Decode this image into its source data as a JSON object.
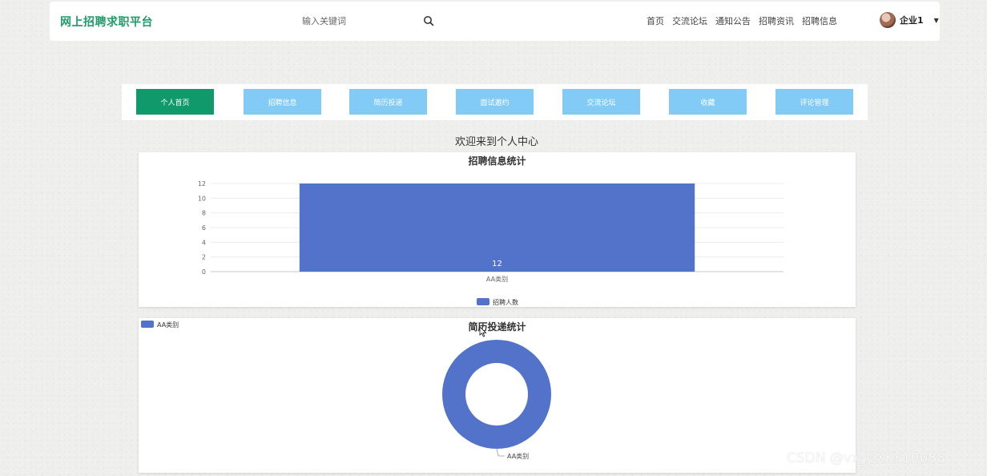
{
  "header": {
    "logo": "网上招聘求职平台",
    "search_placeholder": "输入关键词",
    "nav": [
      "首页",
      "交流论坛",
      "通知公告",
      "招聘资讯",
      "招聘信息"
    ],
    "user_name": "企业1"
  },
  "tabs": [
    "个人首页",
    "招聘信息",
    "简历投递",
    "面试邀约",
    "交流论坛",
    "收藏",
    "评论管理"
  ],
  "active_tab": 0,
  "welcome": "欢迎来到个人中心",
  "colors": {
    "brand": "#1f9a6b",
    "tab": "#83cbf7",
    "tab_active": "#10996b",
    "series": "#5273c9"
  },
  "chart_data": [
    {
      "type": "bar",
      "title": "招聘信息统计",
      "categories": [
        "AA类别"
      ],
      "series": [
        {
          "name": "招聘人数",
          "values": [
            12
          ]
        }
      ],
      "ylim": [
        0,
        12
      ],
      "yticks": [
        0,
        2,
        4,
        6,
        8,
        10,
        12
      ],
      "grid": true,
      "legend": "bottom-center",
      "data_labels": true
    },
    {
      "type": "pie",
      "title": "简历投递统计",
      "labels": [
        "AA类别"
      ],
      "values": [
        1
      ],
      "donut": true,
      "legend": "top-left"
    }
  ],
  "watermark": "CSDN @vx_CXKF10088"
}
